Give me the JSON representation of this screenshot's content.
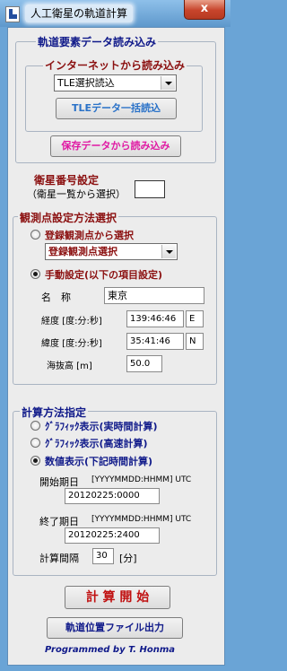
{
  "window": {
    "title": "人工衛星の軌道計算",
    "close": "x"
  },
  "orbit_group": {
    "title": "軌道要素データ読み込み",
    "internet_title": "インターネットから読み込み",
    "tle_select_value": "TLE選択読込",
    "tle_bulk_button": "TLEデータ一括読込",
    "saved_load_button": "保存データから読み込み"
  },
  "satellite": {
    "label_line1": "衛星番号設定",
    "label_line2": "（衛星一覧から選択）",
    "number_value": ""
  },
  "observation_group": {
    "title": "観測点設定方法選択",
    "registered_radio": "登録観測点から選択",
    "registered_select_value": "登録観測点選択",
    "manual_radio": "手動設定(以下の項目設定)",
    "name_label": "名　称",
    "name_value": "東京",
    "longitude_label": "経度 [度:分:秒]",
    "longitude_value": "139:46:46",
    "longitude_dir": "E",
    "latitude_label": "緯度 [度:分:秒]",
    "latitude_value": "35:41:46",
    "latitude_dir": "N",
    "altitude_label": "海抜高 [m]",
    "altitude_value": "50.0"
  },
  "calc_group": {
    "title": "計算方法指定",
    "radio_graphic_realtime": "ｸﾞﾗﾌｨｯｸ表示(実時間計算)",
    "radio_graphic_fast": "ｸﾞﾗﾌｨｯｸ表示(高速計算)",
    "radio_numeric": "数値表示(下記時間計算)",
    "start_label": "開始期日",
    "start_format": "[YYYYMMDD:HHMM] UTC",
    "start_value": "20120225:0000",
    "end_label": "終了期日",
    "end_format": "[YYYYMMDD:HHMM] UTC",
    "end_value": "20120225:2400",
    "interval_label": "計算間隔",
    "interval_value": "30",
    "interval_unit": "[分]"
  },
  "actions": {
    "start_button": "計 算 開 始",
    "export_button": "軌道位置ファイル出力",
    "credit": "Programmed by T. Honma"
  },
  "colors": {
    "accent_red": "#8b1010",
    "navy": "#101a8a",
    "magenta": "#e01aa4",
    "blue_button_text": "#2a72c8"
  }
}
